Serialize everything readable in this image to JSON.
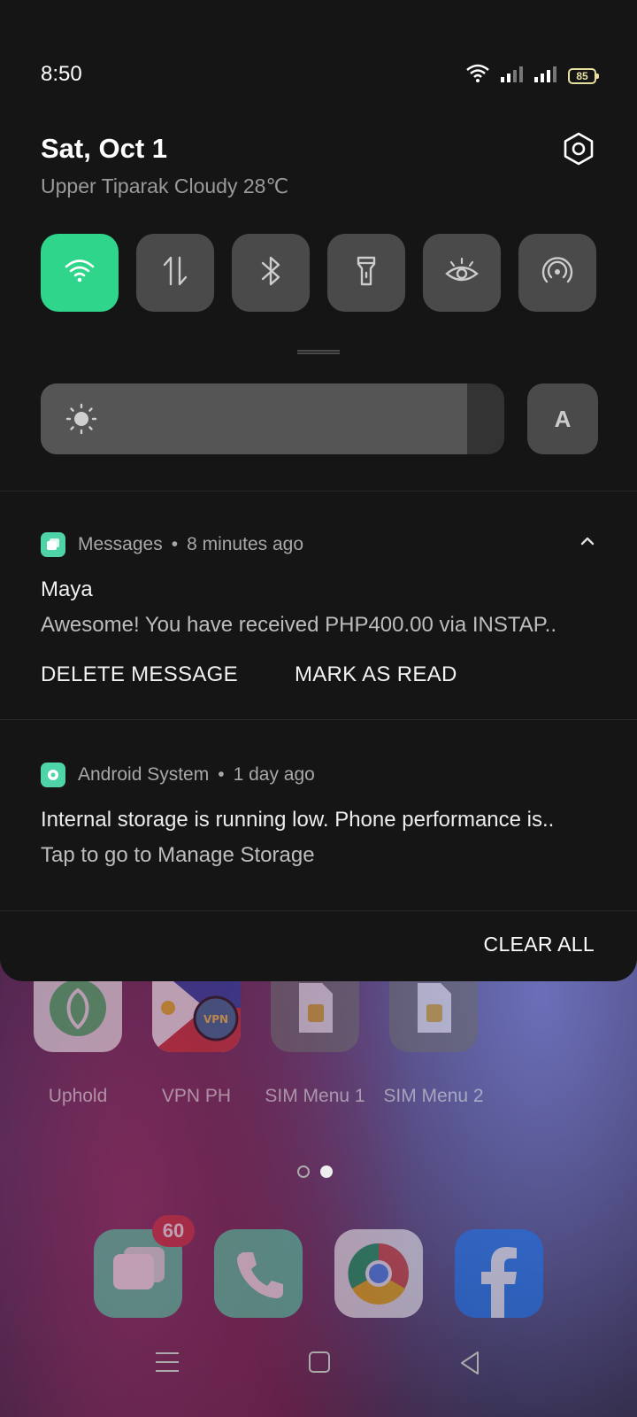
{
  "status_bar": {
    "time": "8:50",
    "battery": "85"
  },
  "header": {
    "date": "Sat, Oct 1",
    "weather": "Upper Tiparak Cloudy 28℃"
  },
  "quick_tiles": [
    {
      "name": "wifi",
      "icon": "wifi-icon",
      "active": true
    },
    {
      "name": "mobile-data",
      "icon": "data-transfer-icon",
      "active": false
    },
    {
      "name": "bluetooth",
      "icon": "bluetooth-icon",
      "active": false
    },
    {
      "name": "flashlight",
      "icon": "flashlight-icon",
      "active": false
    },
    {
      "name": "eye-comfort",
      "icon": "eye-icon",
      "active": false
    },
    {
      "name": "hotspot",
      "icon": "hotspot-icon",
      "active": false
    }
  ],
  "brightness": {
    "level": 0.92,
    "auto_label": "A"
  },
  "notifications": [
    {
      "app": "Messages",
      "time": "8 minutes ago",
      "title": "Maya",
      "body": "Awesome! You have received PHP400.00 via INSTAP..",
      "actions": [
        "DELETE MESSAGE",
        "MARK AS READ"
      ]
    },
    {
      "app": "Android System",
      "time": "1 day ago",
      "body": "Internal storage is running low. Phone performance is..",
      "body2": "Tap to go to Manage Storage"
    }
  ],
  "clear_all_label": "CLEAR ALL",
  "home_apps": [
    {
      "label": "Uphold"
    },
    {
      "label": "VPN PH"
    },
    {
      "label": "SIM Menu 1"
    },
    {
      "label": "SIM Menu 2"
    }
  ],
  "dock": {
    "messages_badge": "60"
  },
  "colors": {
    "accent": "#2fd58a",
    "shade_bg": "#151515",
    "tile_bg": "#4a4a4a"
  }
}
